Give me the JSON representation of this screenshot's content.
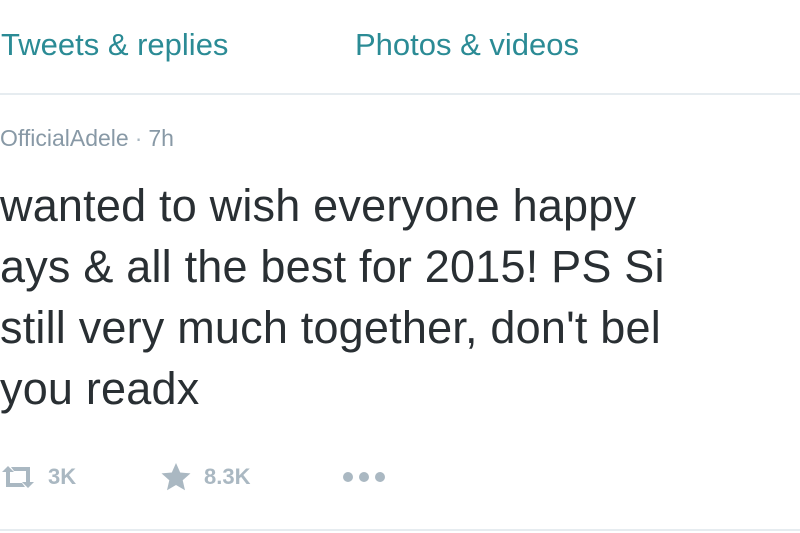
{
  "tabs": {
    "replies_label": "Tweets & replies",
    "media_label": "Photos & videos"
  },
  "tweet": {
    "handle": "OfficialAdele",
    "separator": "·",
    "time": "7h",
    "lines": [
      "wanted to wish everyone happy",
      "ays & all the best for 2015! PS Si",
      "still very much together, don't bel",
      "you readx"
    ],
    "retweet_icon": "retweet-icon",
    "retweet_count": "3K",
    "favorite_icon": "star-icon",
    "favorite_count": "8.3K",
    "more_icon": "more-icon"
  },
  "colors": {
    "accent": "#2b8b95",
    "muted": "#8899a6",
    "text": "#292f33",
    "icon": "#aab8c2",
    "divider": "#e6ecf0"
  }
}
